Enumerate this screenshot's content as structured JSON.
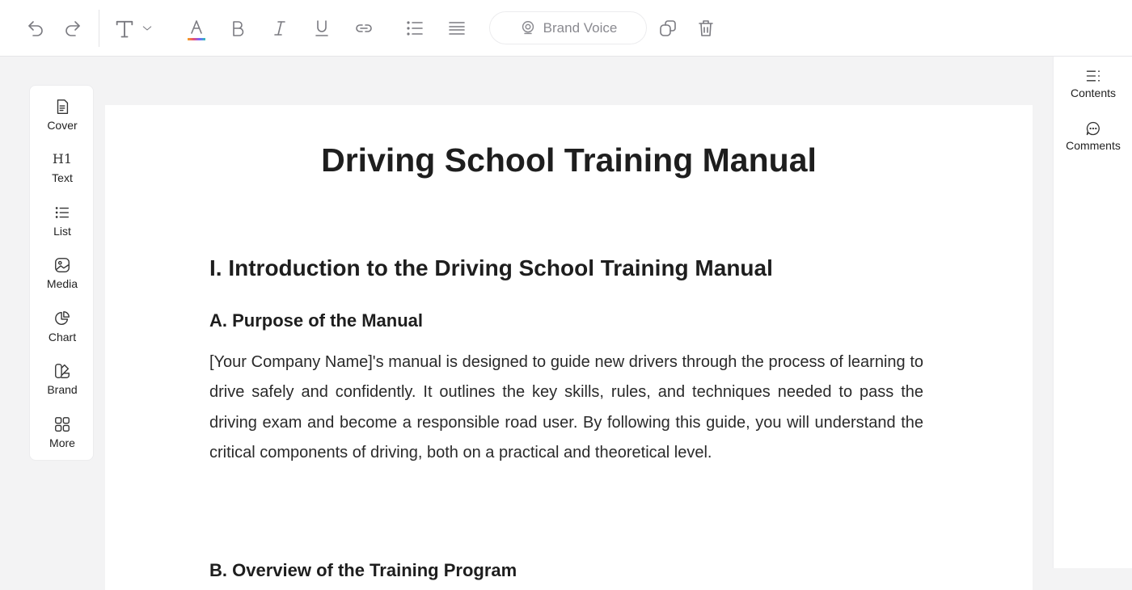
{
  "toolbar": {
    "brand_voice_label": "Brand Voice"
  },
  "left_rail": {
    "items": [
      {
        "label": "Cover",
        "icon": "cover-icon"
      },
      {
        "label": "Text",
        "icon": "heading-h1-icon",
        "glyph": "H1"
      },
      {
        "label": "List",
        "icon": "list-icon"
      },
      {
        "label": "Media",
        "icon": "image-icon"
      },
      {
        "label": "Chart",
        "icon": "chart-icon"
      },
      {
        "label": "Brand",
        "icon": "brand-icon"
      },
      {
        "label": "More",
        "icon": "grid-icon"
      }
    ]
  },
  "right_rail": {
    "contents_label": "Contents",
    "comments_label": "Comments"
  },
  "document": {
    "title": "Driving School Training Manual",
    "section_heading": "I. Introduction to the Driving School Training Manual",
    "subsection_heading": "A. Purpose of the Manual",
    "paragraph": "[Your Company Name]'s manual is designed to guide new drivers through the process of learning to drive safely and confidently. It outlines the key skills, rules, and techniques needed to pass the driving exam and become a responsible road user. By following this guide, you will understand the critical components of driving, both on a practical and theoretical level.",
    "next_subsection_heading": "B. Overview of the Training Program"
  }
}
